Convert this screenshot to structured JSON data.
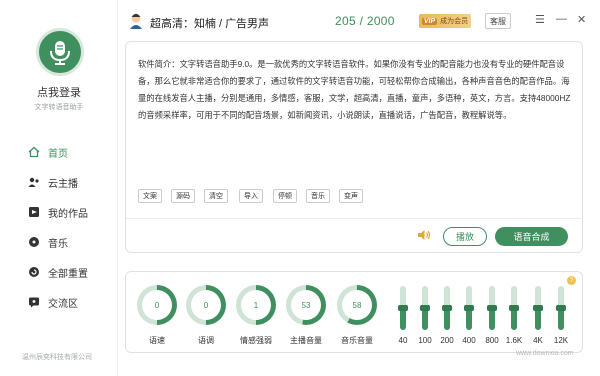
{
  "sidebar": {
    "login_label": "点我登录",
    "app_subtitle": "文字转语音助手",
    "items": [
      {
        "label": "首页",
        "icon": "home-icon",
        "active": true
      },
      {
        "label": "云主播",
        "icon": "cloud-anchor-icon",
        "active": false
      },
      {
        "label": "我的作品",
        "icon": "works-icon",
        "active": false
      },
      {
        "label": "音乐",
        "icon": "music-icon",
        "active": false
      },
      {
        "label": "全部重置",
        "icon": "reset-icon",
        "active": false
      },
      {
        "label": "交流区",
        "icon": "chat-icon",
        "active": false
      }
    ],
    "company": "温州辰奕科技有限公司"
  },
  "header": {
    "voice_quality": "超高清",
    "voice_name": "知楠",
    "sep": "/",
    "voice_style": "广告男声",
    "colon": "：",
    "count_current": "205",
    "count_sep": "/",
    "count_max": "2000",
    "vip_mark": "VIP",
    "vip_label": "成为会员",
    "service_label": "客服",
    "menu_glyph": "☰",
    "minimize_glyph": "—",
    "close_glyph": "✕"
  },
  "editor": {
    "text": "软件简介：文字转语音助手9.0。是一款优秀的文字转语音软件。如果你没有专业的配音能力也没有专业的硬件配音设备，那么它就非常适合你的要求了，通过软件的文字转语音功能，可轻松帮你合成输出，各种声音音色的配音作品。海量的在线发音人主播，分别是通用，多情感，客服，文学，超高清，直播，童声，多语种，英文，方言。支持48000HZ的音频采样率，可用于不同的配音场景，如新闻资讯，小说朗读，直播说话，广告配音，教程解说等。",
    "tools": [
      "文案",
      "源码",
      "清空",
      "导入",
      "停顿",
      "音乐",
      "变声"
    ],
    "play_label": "播放",
    "synthesize_label": "语音合成"
  },
  "dials": [
    {
      "label": "语速",
      "value": "0",
      "level": 0.5
    },
    {
      "label": "语调",
      "value": "0",
      "level": 0.5
    },
    {
      "label": "情感强弱",
      "value": "1",
      "level": 0.5
    },
    {
      "label": "主播音量",
      "value": "53",
      "level": 0.53
    },
    {
      "label": "音乐音量",
      "value": "58",
      "level": 0.58
    }
  ],
  "equalizer": [
    {
      "label": "40",
      "level": 0.5
    },
    {
      "label": "100",
      "level": 0.5
    },
    {
      "label": "200",
      "level": 0.5
    },
    {
      "label": "400",
      "level": 0.5
    },
    {
      "label": "800",
      "level": 0.5
    },
    {
      "label": "1.6K",
      "level": 0.5
    },
    {
      "label": "4K",
      "level": 0.5
    },
    {
      "label": "12K",
      "level": 0.5
    }
  ],
  "help_glyph": "?",
  "watermark": "www.downxia.com",
  "colors": {
    "accent": "#3f8f5f",
    "accent_light": "#cfe3d6",
    "vip": "#e9b85a"
  }
}
